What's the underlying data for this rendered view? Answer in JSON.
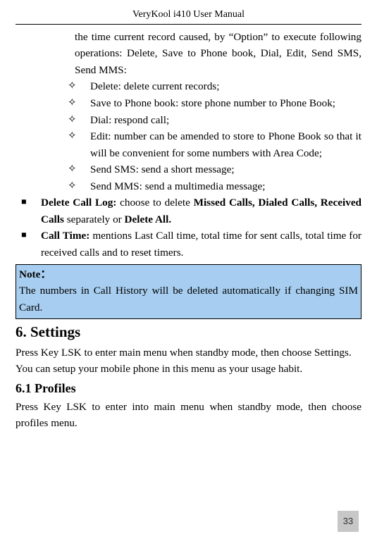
{
  "header": {
    "title": "VeryKool i410 User Manual"
  },
  "intro_continuation": "the time current record caused, by “Option” to execute following operations: Delete, Save to Phone book, Dial, Edit, Send SMS, Send MMS:",
  "diamond_items": [
    "Delete: delete current records;",
    "Save to Phone book: store phone number to Phone Book;",
    "Dial: respond call;",
    "Edit: number can be amended to store to Phone Book so that it will be convenient for some numbers with Area Code;",
    "Send SMS: send a short message;",
    "Send MMS: send a multimedia message;"
  ],
  "square_items": [
    {
      "lead": "Delete Call Log: ",
      "mid1": "choose to delete ",
      "bold2": "Missed Calls, Dialed Calls, Received Calls",
      "mid2": " separately or ",
      "bold3": "Delete All."
    },
    {
      "lead": "Call Time: ",
      "rest": "mentions Last Call time, total time for sent calls, total time for received calls and to reset timers."
    }
  ],
  "note": {
    "label": "Note：",
    "body": "The numbers in Call History will be deleted automatically if changing SIM Card."
  },
  "settings": {
    "heading": "6. Settings",
    "para1": "Press Key LSK to enter main menu when standby mode, then choose Settings.",
    "para2": "You can setup your mobile phone in this menu as your usage habit."
  },
  "profiles": {
    "heading": "6.1 Profiles",
    "para": "Press Key LSK to enter into main menu when standby mode, then choose profiles menu."
  },
  "page_number": "33"
}
